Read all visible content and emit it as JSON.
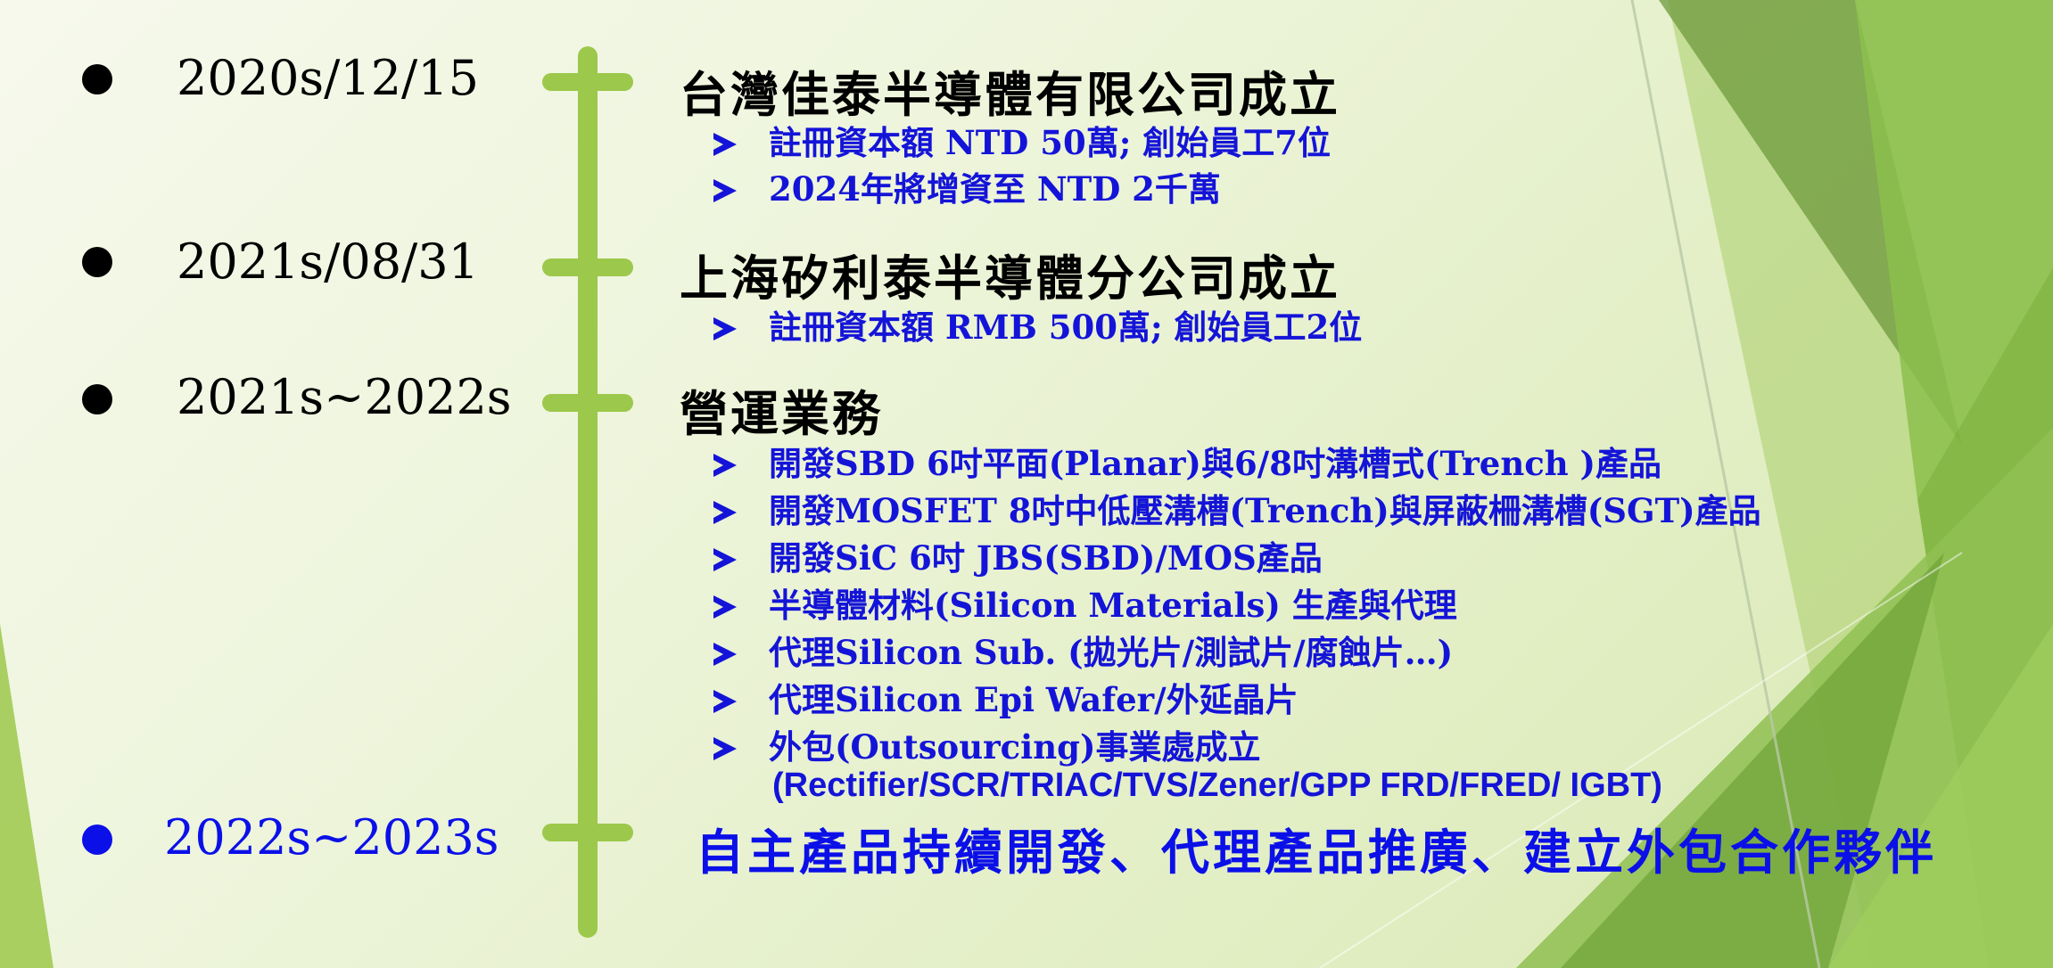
{
  "timeline": [
    {
      "date": "2020s/12/15",
      "heading": "台灣佳泰半導體有限公司成立",
      "items": [
        "註冊資本額 NTD 50萬; 創始員工7位",
        "2024年將增資至 NTD 2千萬"
      ]
    },
    {
      "date": "2021s/08/31",
      "heading": "上海矽利泰半導體分公司成立",
      "items": [
        "註冊資本額 RMB 500萬; 創始員工2位"
      ]
    },
    {
      "date": "2021s~2022s",
      "heading": "營運業務",
      "items": [
        "開發SBD 6吋平面(Planar)與6/8吋溝槽式(Trench )產品",
        "開發MOSFET 8吋中低壓溝槽(Trench)與屏蔽柵溝槽(SGT)產品",
        "開發SiC 6吋 JBS(SBD)/MOS產品",
        "半導體材料(Silicon Materials) 生產與代理",
        "代理Silicon Sub. (拋光片/測試片/腐蝕片…)",
        "代理Silicon Epi Wafer/外延晶片",
        "外包(Outsourcing)事業處成立"
      ],
      "outsourcing_products": "(Rectifier/SCR/TRIAC/TVS/Zener/GPP FRD/FRED/ IGBT)"
    },
    {
      "date": "2022s~2023s",
      "heading": "自主產品持續開發、代理產品推廣、建立外包合作夥伴"
    }
  ],
  "colors": {
    "timeline_green": "#9cc84b",
    "text_blue": "#1414d8",
    "highlight_blue": "#0b10e8",
    "text_black": "#000000"
  }
}
